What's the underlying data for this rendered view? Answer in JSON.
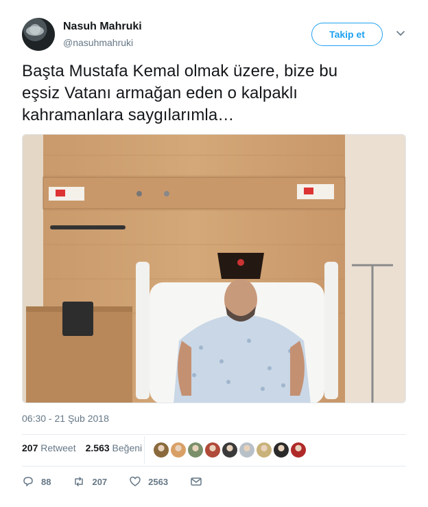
{
  "author": {
    "name": "Nasuh Mahruki",
    "handle": "@nasuhmahruki",
    "avatar_icon": "profile-photo"
  },
  "follow_button": "Takip et",
  "tweet_text": "Başta Mustafa Kemal olmak üzere, bize bu\neşsiz Vatanı armağan eden o kalpaklı\nkahramanlara saygılarımla…",
  "timestamp": "06:30 - 21 Şub 2018",
  "stats": {
    "retweets_count": "207",
    "retweets_label": "Retweet",
    "likes_count": "2.563",
    "likes_label": "Beğeni"
  },
  "liker_avatar_colors": [
    "#8a6a3c",
    "#d9a066",
    "#7a8f6a",
    "#b04a3a",
    "#3a3a3a",
    "#b8c0c8",
    "#c9b27a",
    "#2a2a2a",
    "#b02a2a"
  ],
  "actions": {
    "reply_count": "88",
    "retweet_count": "207",
    "like_count": "2563"
  },
  "colors": {
    "accent": "#1da1f2",
    "muted": "#657786"
  }
}
